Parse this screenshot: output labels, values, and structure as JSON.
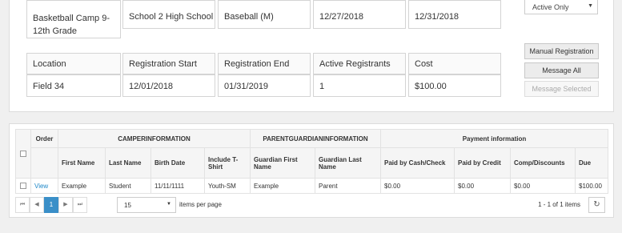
{
  "top": {
    "row1": [
      "Basketball Camp 9-12th Grade",
      "School 2 High School",
      "Baseball (M)",
      "12/27/2018",
      "12/31/2018"
    ],
    "headers": [
      "Location",
      "Registration Start",
      "Registration End",
      "Active Registrants",
      "Cost"
    ],
    "values": [
      "Field 34",
      "12/01/2018",
      "01/31/2019",
      "1",
      "$100.00"
    ]
  },
  "filter": {
    "selected": "Active Only"
  },
  "actions": {
    "manual_registration": "Manual Registration",
    "message_all": "Message All",
    "message_selected": "Message Selected"
  },
  "grid": {
    "groups": {
      "order": "Order",
      "camper": "CAMPERINFORMATION",
      "parent": "PARENTGUARDIANINFORMATION",
      "payment": "Payment information"
    },
    "columns": [
      "First Name",
      "Last Name",
      "Birth Date",
      "Include T-Shirt",
      "Guardian First Name",
      "Guardian Last Name",
      "Paid by Cash/Check",
      "Paid by Credit",
      "Comp/Discounts",
      "Due"
    ],
    "rows": [
      {
        "order": "View",
        "cells": [
          "Example",
          "Student",
          "11/11/1111",
          "Youth-SM",
          "Example",
          "Parent",
          "$0.00",
          "$0.00",
          "$0.00",
          "$100.00"
        ]
      }
    ]
  },
  "pager": {
    "current_page": "1",
    "page_size": "15",
    "items_per_page": "items per page",
    "summary": "1 - 1 of 1 items"
  },
  "icons": {
    "first": "first-page-icon",
    "prev": "prev-page-icon",
    "next": "next-page-icon",
    "last": "last-page-icon",
    "refresh": "refresh-icon"
  }
}
